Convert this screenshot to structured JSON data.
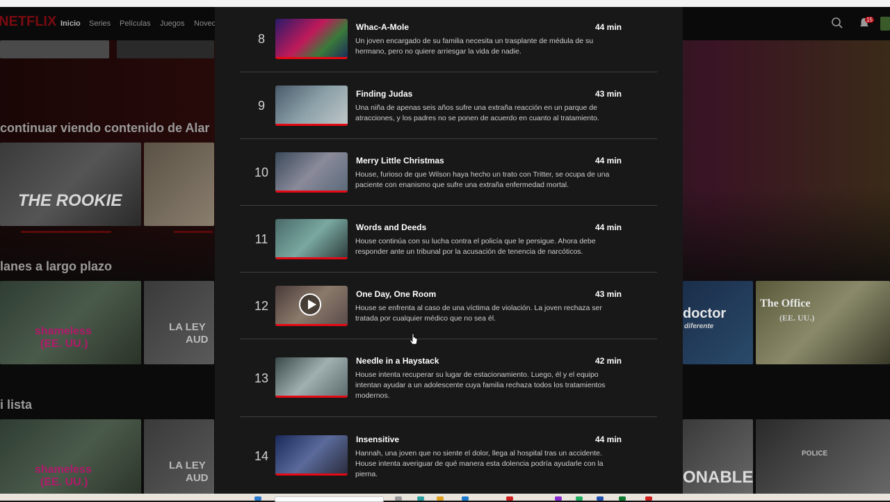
{
  "nav": {
    "logo": "NETFLIX",
    "links": [
      "Inicio",
      "Series",
      "Películas",
      "Juegos",
      "Noved"
    ]
  },
  "rows": [
    {
      "title": "continuar viendo contenido de Alar"
    },
    {
      "title": "lanes a largo plazo"
    },
    {
      "title": "i lista"
    }
  ],
  "tiles": {
    "rookie": "THE ROOKIE",
    "shameless_1": "shameless",
    "shameless_1b": "(EE. UU.)",
    "laley_1": "LA LEY",
    "laley_1b": "AUD",
    "doctor": "doctor",
    "doctor_sub": "diferente",
    "office": "The Office",
    "office_sub": "(EE. UU.)",
    "shameless_2": "shameless",
    "shameless_2b": "(EE. UU.)",
    "laley_2": "LA LEY",
    "laley_2b": "AUD",
    "onable": "ONABLE",
    "police": "POLICE"
  },
  "notifications": {
    "count": "15"
  },
  "episodes": [
    {
      "number": "8",
      "title": "Whac-A-Mole",
      "duration": "44 min",
      "description": "Un joven encargado de su familia necesita un trasplante de médula de su hermano, pero no quiere arriesgar la vida de nadie."
    },
    {
      "number": "9",
      "title": "Finding Judas",
      "duration": "43 min",
      "description": "Una niña de apenas seis años sufre una extraña reacción en un parque de atracciones, y los padres no se ponen de acuerdo en cuanto al tratamiento."
    },
    {
      "number": "10",
      "title": "Merry Little Christmas",
      "duration": "44 min",
      "description": "House, furioso de que Wilson haya hecho un trato con Tritter, se ocupa de una paciente con enanismo que sufre una extraña enfermedad mortal."
    },
    {
      "number": "11",
      "title": "Words and Deeds",
      "duration": "44 min",
      "description": "House continúa con su lucha contra el policía que le persigue. Ahora debe responder ante un tribunal por la acusación de tenencia de narcóticos."
    },
    {
      "number": "12",
      "title": "One Day, One Room",
      "duration": "43 min",
      "description": "House se enfrenta al caso de una víctima de violación. La joven rechaza ser tratada por cualquier médico que no sea él."
    },
    {
      "number": "13",
      "title": "Needle in a Haystack",
      "duration": "42 min",
      "description": "House intenta recuperar su lugar de estacionamiento. Luego, él y el equipo intentan ayudar a un adolescente cuya familia rechaza todos los tratamientos modernos."
    },
    {
      "number": "14",
      "title": "Insensitive",
      "duration": "44 min",
      "description": "Hannah, una joven que no siente el dolor, llega al hospital tras un accidente. House intenta averiguar de qué manera esta dolencia podría ayudarle con la pierna."
    }
  ],
  "colors": {
    "accent": "#e50914",
    "modal_bg": "#181818",
    "page_bg": "#141414"
  }
}
